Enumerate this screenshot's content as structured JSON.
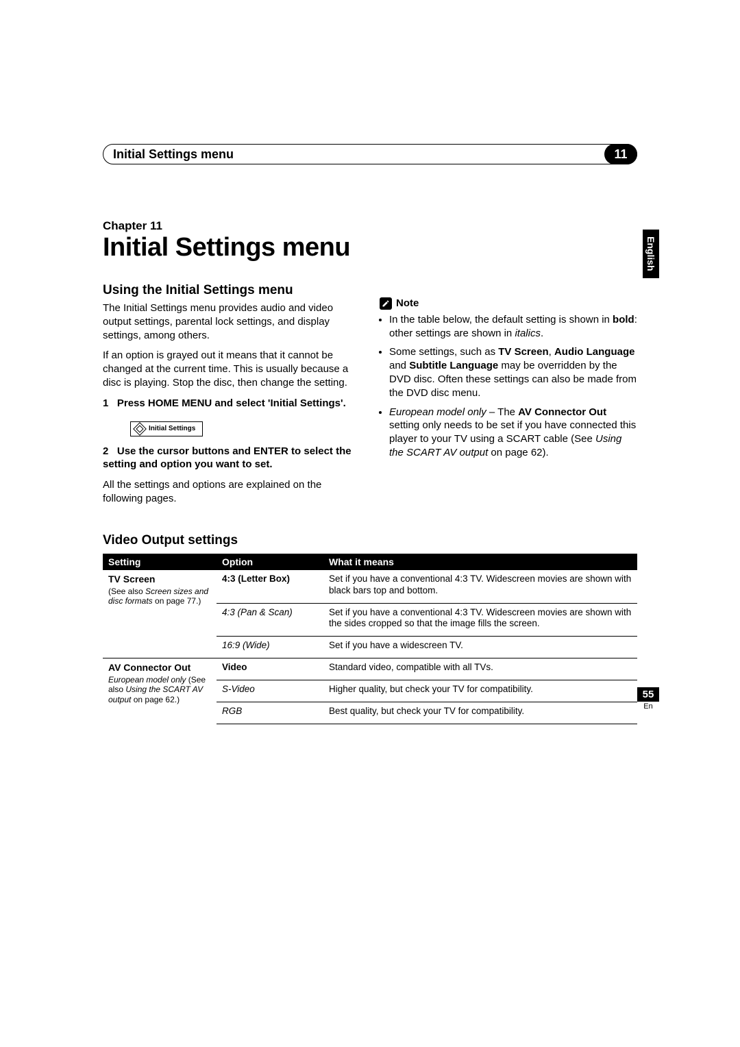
{
  "header": {
    "running_title": "Initial Settings menu",
    "chapter_number": "11"
  },
  "lang_tab": "English",
  "chapter_label": "Chapter 11",
  "main_title": "Initial Settings menu",
  "left_col": {
    "heading": "Using the Initial Settings menu",
    "p1": "The Initial Settings menu provides audio and video output settings, parental lock settings, and display settings, among others.",
    "p2": "If an option is grayed out it means that it cannot be changed at the current time. This is usually because a disc is playing. Stop the disc, then change the setting.",
    "step1_num": "1",
    "step1_text": "Press HOME MENU and select 'Initial Settings'.",
    "osd_label": "Initial Settings",
    "step2_num": "2",
    "step2_text": "Use the cursor buttons and ENTER to select the setting and option you want to set.",
    "p3": "All the settings and options are explained on the following pages."
  },
  "right_col": {
    "note_label": "Note",
    "bullet1_a": "In the table below, the default setting is shown in ",
    "bullet1_b": "bold",
    "bullet1_c": ": other settings are shown in ",
    "bullet1_d": "italics",
    "bullet1_e": ".",
    "bullet2_a": "Some settings, such as ",
    "bullet2_b": "TV Screen",
    "bullet2_c": ", ",
    "bullet2_d": "Audio Language",
    "bullet2_e": " and ",
    "bullet2_f": "Subtitle Language",
    "bullet2_g": " may be overridden by the DVD disc. Often these settings can also be made from the DVD disc menu.",
    "bullet3_a": "European model only",
    "bullet3_b": " – The ",
    "bullet3_c": "AV Connector Out",
    "bullet3_d": " setting only needs to be set if you have connected this player to your TV using a SCART cable (See ",
    "bullet3_e": "Using the SCART AV output",
    "bullet3_f": " on page 62)."
  },
  "table": {
    "heading": "Video Output settings",
    "col1": "Setting",
    "col2": "Option",
    "col3": "What it means",
    "group1": {
      "setting_name": "TV Screen",
      "setting_sub_a": "(See also ",
      "setting_sub_b": "Screen sizes and disc formats",
      "setting_sub_c": " on page 77.)",
      "rows": [
        {
          "opt": "4:3 (Letter Box)",
          "opt_bold": true,
          "desc": "Set if you have a conventional 4:3 TV. Widescreen movies are shown with black bars top and bottom."
        },
        {
          "opt": "4:3 (Pan & Scan)",
          "opt_bold": false,
          "desc": "Set if you have a conventional 4:3 TV. Widescreen movies are shown with the sides cropped so that the image fills the screen."
        },
        {
          "opt": "16:9 (Wide)",
          "opt_bold": false,
          "desc": "Set if you have a widescreen TV."
        }
      ]
    },
    "group2": {
      "setting_name": "AV Connector Out",
      "setting_sub_a": "European model only",
      "setting_sub_b": " (See also ",
      "setting_sub_c": "Using the SCART AV output",
      "setting_sub_d": " on page 62.)",
      "rows": [
        {
          "opt": "Video",
          "opt_bold": true,
          "desc": "Standard video, compatible with all TVs."
        },
        {
          "opt": "S-Video",
          "opt_bold": false,
          "desc": "Higher quality, but check your TV for compatibility."
        },
        {
          "opt": "RGB",
          "opt_bold": false,
          "desc": "Best quality, but check your TV for compatibility."
        }
      ]
    }
  },
  "footer": {
    "page": "55",
    "lang": "En"
  }
}
